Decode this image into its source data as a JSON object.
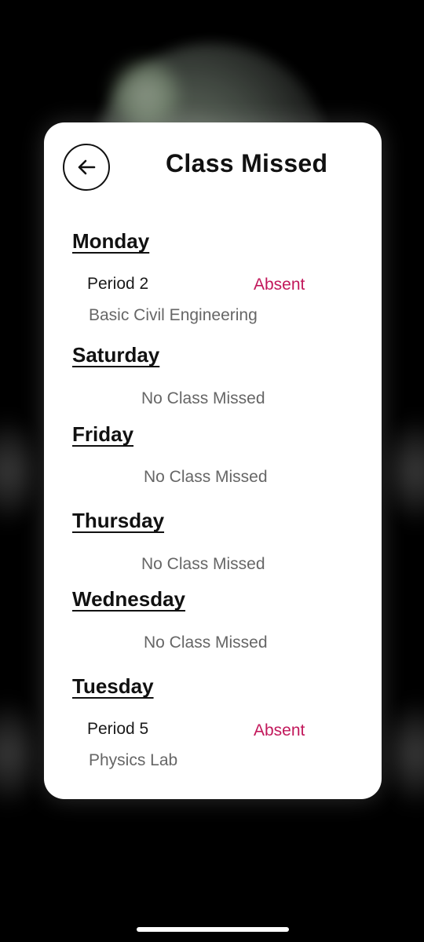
{
  "header": {
    "title": "Class Missed",
    "back_icon": "arrow-left-icon"
  },
  "days": [
    {
      "day": "Monday",
      "entries": [
        {
          "period": "Period 2",
          "status": "Absent",
          "subject": "Basic Civil Engineering"
        }
      ]
    },
    {
      "day": "Saturday",
      "empty_text": "No Class Missed"
    },
    {
      "day": "Friday",
      "empty_text": "No Class Missed"
    },
    {
      "day": "Thursday",
      "empty_text": "No Class Missed"
    },
    {
      "day": "Wednesday",
      "empty_text": "No Class Missed"
    },
    {
      "day": "Tuesday",
      "entries": [
        {
          "period": "Period 5",
          "status": "Absent",
          "subject": "Physics Lab"
        }
      ]
    }
  ],
  "colors": {
    "absent": "#c2185b",
    "card": "#ffffff",
    "background": "#000000"
  }
}
